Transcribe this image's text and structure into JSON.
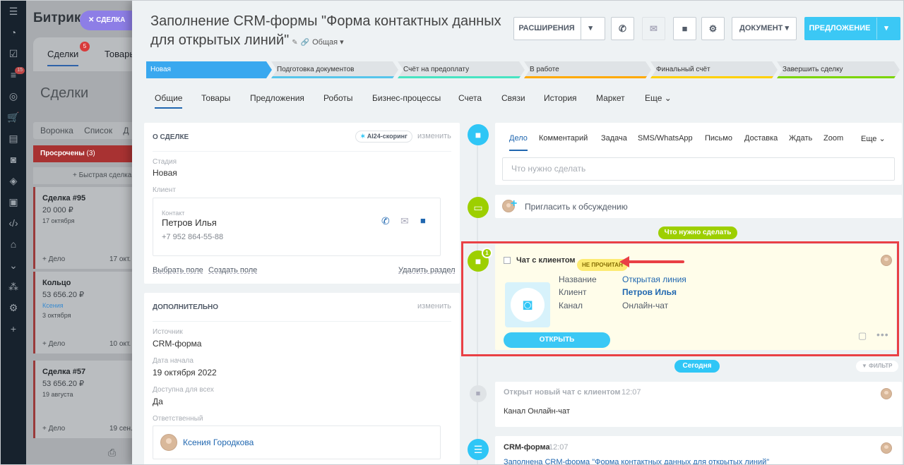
{
  "background": {
    "nav_icons": [
      "menu-icon",
      "pulse-icon",
      "tasks-icon",
      "filter-icon",
      "target-icon",
      "cart-icon",
      "contacts-icon",
      "robot-icon",
      "stack-icon",
      "box-icon",
      "code-icon",
      "store-icon",
      "chevron-circle-icon",
      "sitemap-icon",
      "settings-icon",
      "plus-icon"
    ],
    "nav_badge": "15",
    "brand": "Битрик",
    "pill": "✕ СДЕЛКА",
    "tab1": "Сделки",
    "tab1_badge": "5",
    "tab2": "Товары",
    "title": "Сделки",
    "filter": "Воронка Список Д",
    "overdue": "Просрочены",
    "overdue_count": "(3)",
    "quick": "+ Быстрая сделка",
    "cards": [
      {
        "title": "Сделка #95",
        "sum": "20 000 ₽",
        "date": "17 октября",
        "link": "",
        "add": "+ Дело",
        "right": "17 окт."
      },
      {
        "title": "Кольцо",
        "sum": "53 656.20 ₽",
        "date": "3 октября",
        "link": "Ксения",
        "add": "+ Дело",
        "right": "10 окт."
      },
      {
        "title": "Сделка #57",
        "sum": "53 656.20 ₽",
        "date": "19 августа",
        "link": "",
        "add": "+ Дело",
        "right": "19 сен."
      }
    ]
  },
  "header": {
    "title": "Заполнение CRM-формы \"Форма контактных данных для открытых линий\"",
    "category": "Общая",
    "btn_extensions": "РАСШИРЕНИЯ",
    "btn_document": "ДОКУМЕНТ",
    "btn_offer": "ПРЕДЛОЖЕНИЕ"
  },
  "stages": [
    {
      "label": "Новая",
      "color": "#39a8ef"
    },
    {
      "label": "Подготовка документов",
      "color": "#56c5eb"
    },
    {
      "label": "Счёт на предоплату",
      "color": "#47e4c2"
    },
    {
      "label": "В работе",
      "color": "#ffa900"
    },
    {
      "label": "Финальный счёт",
      "color": "#ffd000"
    },
    {
      "label": "Завершить сделку",
      "color": "#7bd500"
    }
  ],
  "tabs": [
    "Общие",
    "Товары",
    "Предложения",
    "Роботы",
    "Бизнес-процессы",
    "Счета",
    "Связи",
    "История",
    "Маркет",
    "Еще ⌄"
  ],
  "about": {
    "title": "О СДЕЛКЕ",
    "scoring": "AI24-скоринг",
    "edit": "изменить",
    "stage_label": "Стадия",
    "stage_value": "Новая",
    "client_label": "Клиент",
    "contact_label": "Контакт",
    "contact_name": "Петров Илья",
    "contact_phone": "+7 952 864-55-88",
    "select_field": "Выбрать поле",
    "create_field": "Создать поле",
    "delete_section": "Удалить раздел"
  },
  "extra": {
    "title": "ДОПОЛНИТЕЛЬНО",
    "edit": "изменить",
    "source_label": "Источник",
    "source_value": "CRM-форма",
    "start_label": "Дата начала",
    "start_value": "19 октября 2022",
    "avail_label": "Доступна для всех",
    "avail_value": "Да",
    "resp_label": "Ответственный",
    "resp_name": "Ксения Городкова"
  },
  "activity": {
    "tabs": [
      "Дело",
      "Комментарий",
      "Задача",
      "SMS/WhatsApp",
      "Письмо",
      "Доставка",
      "Ждать",
      "Zoom",
      "Еще ⌄"
    ],
    "placeholder": "Что нужно сделать"
  },
  "invite": "Пригласить к обсуждению",
  "todo_pill": "Что нужно сделать",
  "chat": {
    "badge": "1",
    "title": "Чат с клиентом",
    "unread": "НЕ ПРОЧИТАН",
    "name_label": "Название",
    "name_value": "Открытая линия",
    "client_label": "Клиент",
    "client_value": "Петров Илья",
    "channel_label": "Канал",
    "channel_value": "Онлайн-чат",
    "open_btn": "ОТКРЫТЬ"
  },
  "today_pill": "Сегодня",
  "filter_btn": "ФИЛЬТР",
  "event1": {
    "title": "Открыт новый чат с клиентом",
    "time": "12:07",
    "text": "Канал Онлайн-чат"
  },
  "event2": {
    "title": "CRM-форма",
    "time": "12:07",
    "text": "Заполнена CRM-форма \"Форма контактных данных для открытых линий\""
  },
  "colors": {
    "accent": "#2fc6f6",
    "green": "#9dcf00",
    "highlight": "#e94045",
    "link": "#2067b0"
  }
}
